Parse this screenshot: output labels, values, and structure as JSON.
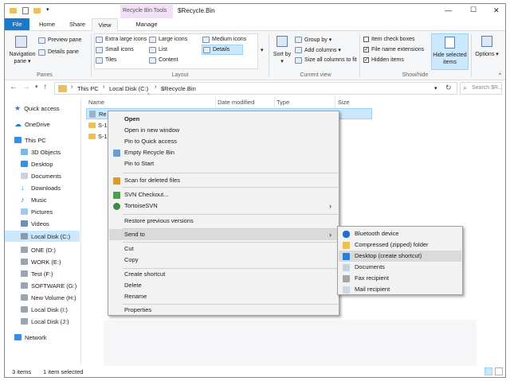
{
  "title": "$Recycle.Bin",
  "contextual_tab_group": "Recycle Bin Tools",
  "window_controls": {
    "minimize": "—",
    "maximize": "☐",
    "close": "✕"
  },
  "tabs": {
    "file": "File",
    "home": "Home",
    "share": "Share",
    "view": "View",
    "manage": "Manage"
  },
  "ribbon": {
    "navigation_pane": "Navigation pane ▾",
    "preview_pane": "Preview pane",
    "details_pane": "Details pane",
    "panes_label": "Panes",
    "layout": {
      "extra_large_icons": "Extra large icons",
      "large_icons": "Large icons",
      "medium_icons": "Medium icons",
      "small_icons": "Small icons",
      "list": "List",
      "details": "Details",
      "tiles": "Tiles",
      "content": "Content",
      "label": "Layout"
    },
    "sort_by": "Sort by ▾",
    "group_by": "Group by ▾",
    "add_columns": "Add columns ▾",
    "size_all_columns": "Size all columns to fit",
    "current_view_label": "Current view",
    "item_check_boxes": "Item check boxes",
    "file_name_extensions": "File name extensions",
    "hidden_items": "Hidden items",
    "hide_selected_items": "Hide selected items",
    "show_hide_label": "Show/hide",
    "options": "Options ▾"
  },
  "address": {
    "crumbs": [
      "This PC",
      "Local Disk (C:)",
      "$Recycle.Bin"
    ],
    "search_placeholder": "Search $R..."
  },
  "nav": {
    "quick_access": "Quick access",
    "onedrive": "OneDrive",
    "this_pc": "This PC",
    "items": [
      "3D Objects",
      "Desktop",
      "Documents",
      "Downloads",
      "Music",
      "Pictures",
      "Videos",
      "Local Disk (C:)",
      "ONE (D:)",
      "WORK (E:)",
      "Test (F:)",
      "SOFTWARE (G:)",
      "New Volume (H:)",
      "Local Disk (I:)",
      "Local Disk (J:)"
    ],
    "network": "Network"
  },
  "columns": {
    "name": "Name",
    "date_modified": "Date modified",
    "type": "Type",
    "size": "Size"
  },
  "files": [
    "Re",
    "S-1",
    "S-1"
  ],
  "status": {
    "items": "3 items",
    "selected": "1 item selected"
  },
  "context_menu": {
    "open": "Open",
    "open_new_window": "Open in new window",
    "pin_quick_access": "Pin to Quick access",
    "empty_recycle_bin": "Empty Recycle Bin",
    "pin_start": "Pin to Start",
    "scan_deleted": "Scan for deleted files",
    "svn_checkout": "SVN Checkout...",
    "tortoise_svn": "TortoiseSVN",
    "restore_versions": "Restore previous versions",
    "send_to": "Send to",
    "cut": "Cut",
    "copy": "Copy",
    "create_shortcut": "Create shortcut",
    "delete": "Delete",
    "rename": "Rename",
    "properties": "Properties"
  },
  "send_to_menu": [
    "Bluetooth device",
    "Compressed (zipped) folder",
    "Desktop (create shortcut)",
    "Documents",
    "Fax recipient",
    "Mail recipient"
  ],
  "colors": {
    "accent": "#1979ca",
    "selection": "#cce8ff",
    "contextual_tab": "#f0e0f7"
  }
}
